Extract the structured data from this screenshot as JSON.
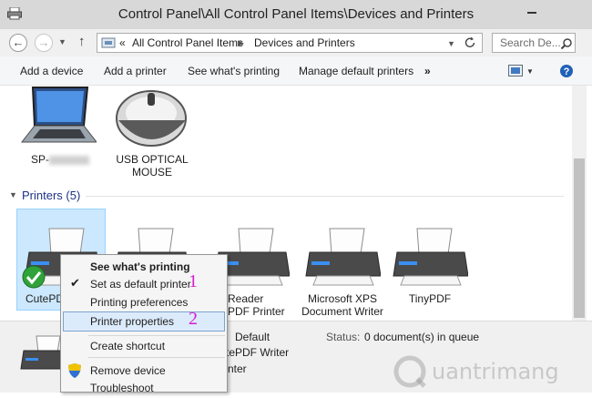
{
  "window": {
    "title": "Control Panel\\All Control Panel Items\\Devices and Printers"
  },
  "address": {
    "overflow": "«",
    "crumbs": [
      "All Control Panel Items",
      "Devices and Printers"
    ],
    "search_placeholder": "Search De..."
  },
  "commands": {
    "items": [
      "Add a device",
      "Add a printer",
      "See what's printing",
      "Manage default printers"
    ],
    "more": "»"
  },
  "devices": [
    {
      "label": "SP-",
      "icon": "laptop-icon"
    },
    {
      "label": "USB OPTICAL MOUSE",
      "icon": "mouse-icon"
    }
  ],
  "printers_group": {
    "label": "Printers (5)"
  },
  "printers": [
    {
      "label": "CutePDF",
      "icon": "printer-icon",
      "is_default": true
    },
    {
      "label": "",
      "icon": "printer-icon"
    },
    {
      "label": "Reader PDF Printer",
      "icon": "printer-icon"
    },
    {
      "label": "Microsoft XPS Document Writer",
      "icon": "printer-icon"
    },
    {
      "label": "TinyPDF",
      "icon": "printer-icon"
    }
  ],
  "details": {
    "state_value": "Default",
    "model_value": "tePDF Writer",
    "category_value": "nter",
    "status_label": "Status:",
    "status_value": "0 document(s) in queue"
  },
  "context_menu": {
    "items": [
      {
        "label": "See what's printing",
        "bold": true
      },
      {
        "label": "Set as default printer",
        "checked": true
      },
      {
        "label": "Printing preferences"
      },
      {
        "label": "Printer properties",
        "highlighted": true
      },
      {
        "label": "Create shortcut"
      },
      {
        "label": "Remove device",
        "icon": "shield-icon"
      },
      {
        "label": "Troubleshoot"
      }
    ]
  },
  "annotations": {
    "step1": "1",
    "step2": "2"
  },
  "watermark": {
    "text": "uantrimang"
  },
  "colors": {
    "accent": "#1e3287",
    "annotation": "#d81bd0",
    "selection": "#cce8ff"
  }
}
